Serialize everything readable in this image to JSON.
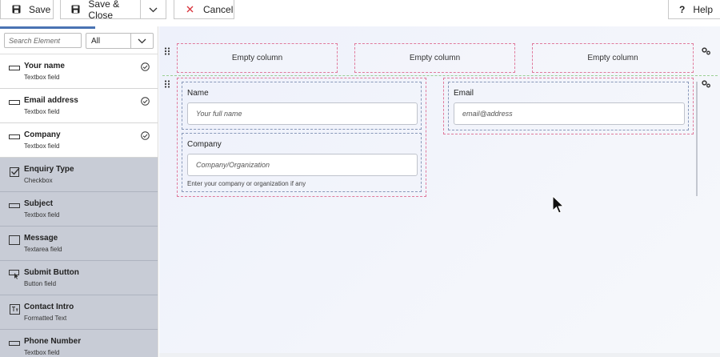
{
  "toolbar": {
    "save_label": "Save",
    "save_close_label": "Save & Close",
    "cancel_label": "Cancel",
    "help_label": "Help",
    "help_glyph": "?"
  },
  "sidebar": {
    "search_placeholder": "Search Element",
    "filter_value": "All",
    "elements": [
      {
        "name": "Your name",
        "type": "Textbox field",
        "icon": "textbox-icon",
        "used": false,
        "checked": true
      },
      {
        "name": "Email address",
        "type": "Textbox field",
        "icon": "textbox-icon",
        "used": false,
        "checked": true
      },
      {
        "name": "Company",
        "type": "Textbox field",
        "icon": "textbox-icon",
        "used": false,
        "checked": true
      },
      {
        "name": "Enquiry Type",
        "type": "Checkbox",
        "icon": "checkbox-icon",
        "used": true,
        "checked": false
      },
      {
        "name": "Subject",
        "type": "Textbox field",
        "icon": "textbox-icon",
        "used": true,
        "checked": false
      },
      {
        "name": "Message",
        "type": "Textarea field",
        "icon": "textarea-icon",
        "used": true,
        "checked": false
      },
      {
        "name": "Submit Button",
        "type": "Button field",
        "icon": "button-icon",
        "used": true,
        "checked": false
      },
      {
        "name": "Contact Intro",
        "type": "Formatted Text",
        "icon": "formatted-text-icon",
        "used": true,
        "checked": false
      },
      {
        "name": "Phone Number",
        "type": "Textbox field",
        "icon": "textbox-icon",
        "used": true,
        "checked": false
      }
    ]
  },
  "canvas": {
    "row1": {
      "columns": [
        "Empty column",
        "Empty column",
        "Empty column"
      ]
    },
    "row2": {
      "name_field": {
        "label": "Name",
        "placeholder": "Your full name"
      },
      "company_field": {
        "label": "Company",
        "placeholder": "Company/Organization",
        "help": "Enter your company or organization if any"
      },
      "email_field": {
        "label": "Email",
        "placeholder": "email@address"
      }
    }
  },
  "colors": {
    "accent": "#4a73b3",
    "used_item_bg": "#c8ccd6",
    "cancel_x": "#d9363e",
    "column_border": "#e07a9c",
    "field_border": "#8898b9",
    "row_divider": "#9bcf94"
  }
}
